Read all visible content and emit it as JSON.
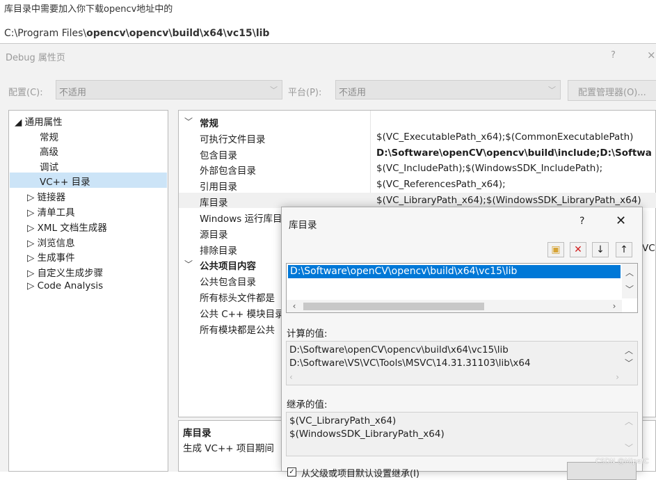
{
  "article": {
    "line1": "库目录中需要加入你下载opencv地址中的",
    "path_prefix": "C:\\Program Files\\",
    "path_bold": "opencv\\opencv\\build\\x64\\vc15\\lib"
  },
  "window": {
    "title": "Debug 属性页",
    "help": "?",
    "close": "×",
    "config_label": "配置(C):",
    "config_value": "不适用",
    "platform_label": "平台(P):",
    "platform_value": "不适用",
    "config_manager": "配置管理器(O)..."
  },
  "tree": {
    "root": "◢ 通用属性",
    "items": [
      "常规",
      "高级",
      "调试",
      "VC++ 目录"
    ],
    "collapsed": [
      "▷ 链接器",
      "▷ 清单工具",
      "▷ XML 文档生成器",
      "▷ 浏览信息",
      "▷ 生成事件",
      "▷ 自定义生成步骤",
      "▷ Code Analysis"
    ]
  },
  "grid": {
    "section1": "常规",
    "rows": [
      {
        "name": "可执行文件目录",
        "value": "$(VC_ExecutablePath_x64);$(CommonExecutablePath)"
      },
      {
        "name": "包含目录",
        "value": "D:\\Software\\openCV\\opencv\\build\\include;D:\\Softwa"
      },
      {
        "name": "外部包含目录",
        "value": "$(VC_IncludePath);$(WindowsSDK_IncludePath);"
      },
      {
        "name": "引用目录",
        "value": "$(VC_ReferencesPath_x64);"
      },
      {
        "name": "库目录",
        "value": "$(VC_LibraryPath_x64);$(WindowsSDK_LibraryPath_x64)"
      },
      {
        "name": "Windows 运行库目",
        "value": ""
      },
      {
        "name": "源目录",
        "value": ""
      },
      {
        "name": "排除目录",
        "value": "VC"
      }
    ],
    "section2": "公共项目内容",
    "rows2": [
      "公共包含目录",
      "所有标头文件都是",
      "公共 C++ 模块目录",
      "所有模块都是公共"
    ],
    "desc_title": "库目录",
    "desc_text": "生成 VC++ 项目期间"
  },
  "dialog": {
    "title": "库目录",
    "help": "?",
    "close": "✕",
    "list_item": "D:\\Software\\openCV\\opencv\\build\\x64\\vc15\\lib",
    "computed_label": "计算的值:",
    "computed": [
      "D:\\Software\\openCV\\opencv\\build\\x64\\vc15\\lib",
      "D:\\Software\\VS\\VC\\Tools\\MSVC\\14.31.31103\\lib\\x64"
    ],
    "inherited_label": "继承的值:",
    "inherited": [
      "$(VC_LibraryPath_x64)",
      "$(WindowsSDK_LibraryPath_x64)"
    ],
    "inherit_checkbox": "从父级或项目默认设置继承(I)"
  },
  "watermark": "CSDN @Mipe!C",
  "icons": {
    "new_folder": "folder-icon",
    "delete": "delete-icon",
    "move_down": "arrow-down-icon",
    "move_up": "arrow-up-icon"
  }
}
